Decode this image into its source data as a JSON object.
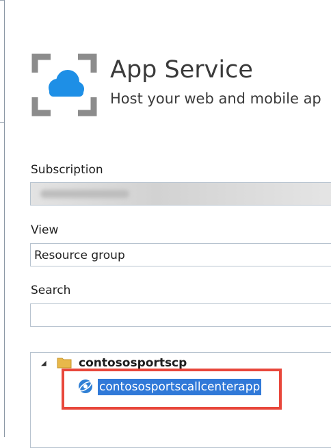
{
  "header": {
    "title": "App Service",
    "subtitle": "Host your web and mobile ap"
  },
  "subscription": {
    "label": "Subscription",
    "value": ""
  },
  "view": {
    "label": "View",
    "value": "Resource group"
  },
  "search": {
    "label": "Search",
    "value": ""
  },
  "tree": {
    "group": "contososportscp",
    "item": "contososportscallcenterapp"
  },
  "colors": {
    "accent": "#3079d8",
    "highlight_border": "#e8473b",
    "logo_gray": "#8c8c8c",
    "cloud_blue": "#1e8fe6"
  },
  "icons": {
    "logo": "app-service-icon",
    "folder": "folder-icon",
    "app": "web-app-icon",
    "toggle": "collapse-triangle-icon"
  }
}
